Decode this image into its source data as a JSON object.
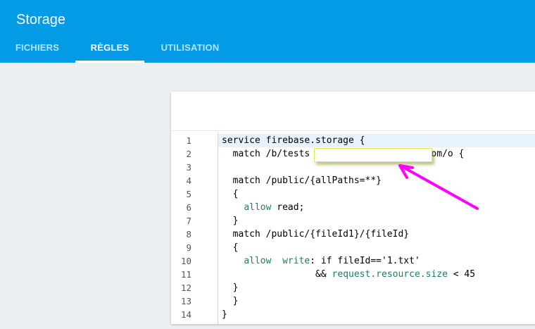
{
  "header": {
    "title": "Storage",
    "tabs": [
      {
        "label": "FICHIERS",
        "active": false
      },
      {
        "label": "RÈGLES",
        "active": true
      },
      {
        "label": "UTILISATION",
        "active": false
      }
    ],
    "color": "#039be5"
  },
  "editor": {
    "line_numbers": [
      "1",
      "2",
      "3",
      "4",
      "5",
      "6",
      "7",
      "8",
      "9",
      "10",
      "11",
      "12",
      "13",
      "14"
    ],
    "lines": [
      {
        "plain": "service firebase.storage {"
      },
      {
        "plain": "  match /b/tests                    .com/o {"
      },
      {
        "plain": ""
      },
      {
        "plain": "  match /public/{allPaths=**}"
      },
      {
        "plain": "  {"
      },
      {
        "kw": "allow",
        "rest": " read;",
        "indent": "    "
      },
      {
        "plain": "  }"
      },
      {
        "plain": "  match /public/{fileId1}/{fileId}"
      },
      {
        "plain": "  {"
      },
      {
        "kw": "allow",
        "kw2": "write",
        "mid": "  ",
        "rest": ": if fileId=='1.txt'",
        "indent": "    "
      },
      {
        "kw": "request.resource.size",
        "rest": " < 45",
        "indent": "                 && "
      },
      {
        "plain": "  }"
      },
      {
        "plain": "  }"
      },
      {
        "plain": "}"
      }
    ],
    "keyword_color": "#1a7f64",
    "active_line": 1
  },
  "annotation": {
    "arrow_color": "#ff00ff",
    "redaction_border": "#ede84a"
  }
}
